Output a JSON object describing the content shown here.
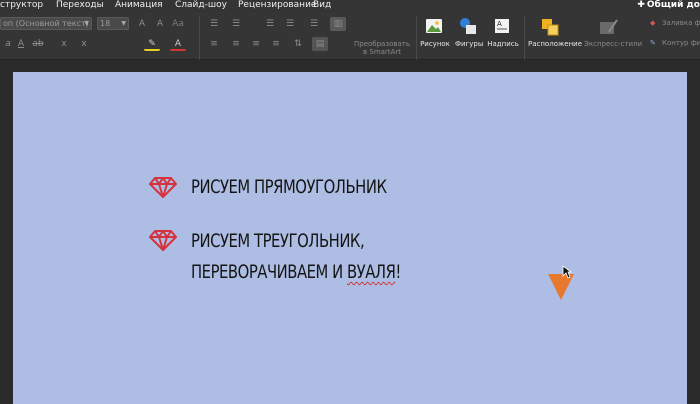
{
  "menu": {
    "items": [
      "структор",
      "Переходы",
      "Анимация",
      "Слайд-шоу",
      "Рецензирование",
      "Вид"
    ],
    "share_label": "Общий до"
  },
  "ribbon": {
    "font_name": "оп (Основной текст)",
    "font_size": "18",
    "font_buttons": [
      "A",
      "A",
      "Aa",
      "A",
      "ab",
      "x",
      "x",
      "A",
      "A"
    ],
    "smartart_label_line1": "Преобразовать",
    "smartart_label_line2": "в SmartArt",
    "picture_label": "Рисунок",
    "shapes_label": "Фигуры",
    "textbox_label": "Надпись",
    "arrange_label": "Расположение",
    "quick_styles_label": "Экспресс-стили",
    "shape_fill_label": "Заливка фи",
    "shape_outline_label": "Контур фи"
  },
  "slide": {
    "bullet1": "Рисуем прямоугольник",
    "bullet2_line1": "Рисуем треугольник,",
    "bullet2_line2_prefix": "переворачиваем и ",
    "bullet2_line2_misspelled": "вуаля",
    "bullet2_line2_suffix": "!"
  },
  "colors": {
    "slide_bg": "#adbde3",
    "gem_red": "#d6323e",
    "triangle": "#e8782e",
    "chrome": "#353535"
  },
  "icons": [
    "diamond-icon",
    "picture-icon",
    "shapes-icon",
    "textbox-icon",
    "arrange-icon",
    "quick-styles-icon",
    "paint-bucket-icon",
    "pen-icon"
  ]
}
